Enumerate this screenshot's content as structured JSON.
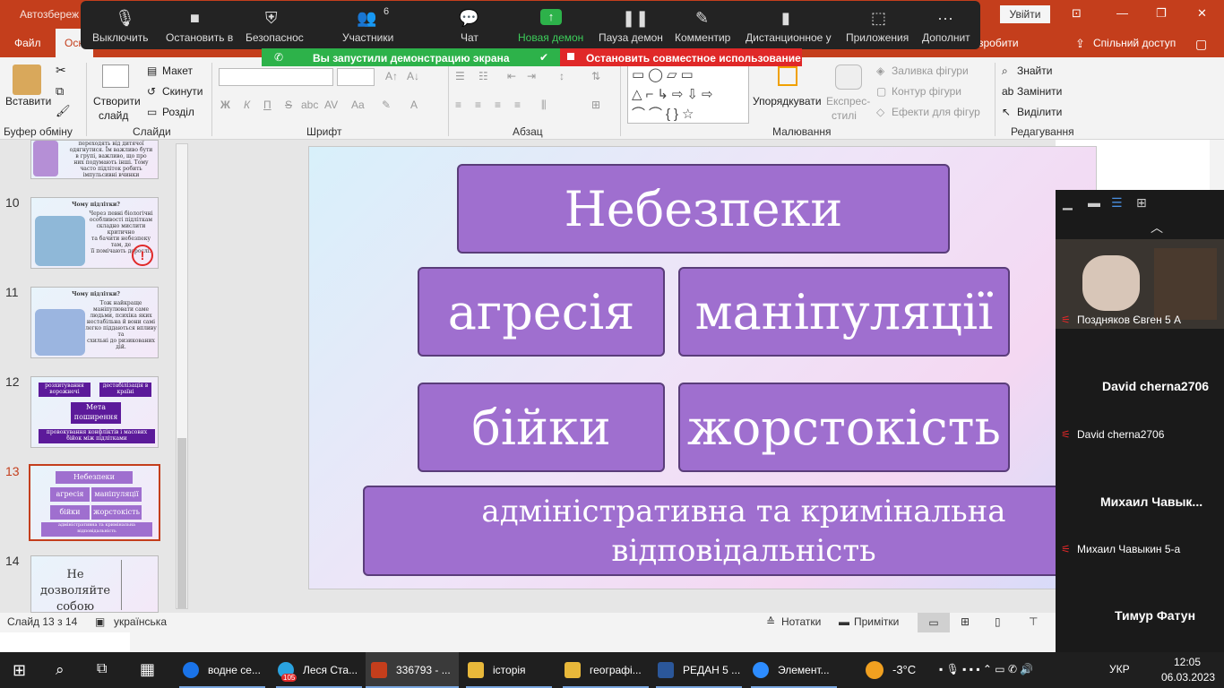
{
  "title_bar": {
    "autosave": "Автозбереж",
    "signin": "Увійти",
    "minimize": "—",
    "maximize": "❐",
    "close": "✕"
  },
  "tabs": {
    "file": "Файл",
    "home": "Осн",
    "tell_me": "зробити",
    "share": "Спільний доступ"
  },
  "zoom": {
    "mute": "Выключить",
    "video": "Остановить в",
    "security": "Безопаснос",
    "participants": "Участники",
    "participants_count": "6",
    "chat": "Чат",
    "share": "Новая демон",
    "pause": "Пауза демон",
    "annotate": "Комментир",
    "remote": "Дистанционное у",
    "apps": "Приложения",
    "more": "Дополнит",
    "banner_sharing": "Вы запустили демонстрацию экрана",
    "banner_stop": "Остановить совместное использование"
  },
  "ribbon": {
    "clipboard": {
      "paste": "Вставити",
      "label": "Буфер обміну"
    },
    "slides": {
      "new_slide_1": "Створити",
      "new_slide_2": "слайд",
      "layout": "Макет",
      "reset": "Скинути",
      "section": "Розділ",
      "label": "Слайди"
    },
    "font": {
      "label": "Шрифт",
      "bold": "Ж",
      "italic": "К",
      "underline": "П",
      "strike": "S",
      "abc": "abc",
      "spacing": "AV",
      "case": "Aa"
    },
    "paragraph": {
      "label": "Абзац"
    },
    "drawing": {
      "arrange": "Упорядкувати",
      "quick_styles_1": "Експрес-",
      "quick_styles_2": "стилі",
      "fill": "Заливка фігури",
      "outline": "Контур фігури",
      "effects": "Ефекти для фігур",
      "label": "Малювання"
    },
    "editing": {
      "find": "Знайти",
      "replace": "Замінити",
      "select": "Виділити",
      "label": "Редагування"
    }
  },
  "thumbnails": [
    {
      "num": "",
      "lines": [
        "переходять від дитячої",
        "одягнутися. Їм важливо бути",
        "в групі, важливо, що про",
        "них подумають інші. Тому",
        "часто підліток робить",
        "імпульсивні вчинки"
      ]
    },
    {
      "num": "10",
      "title": "Чому підлітки?",
      "lines": [
        "Через певні біологічні",
        "особливості підліткам",
        "складно мислити критично",
        "та бачити небезпеку там, де",
        "її помічають дорослі."
      ]
    },
    {
      "num": "11",
      "title": "Чому підлітки?",
      "lines": [
        "Тож найкраще",
        "маніпулювати саме",
        "людьми, психіка яких",
        "нестабільна й вони самі",
        "легко піддаються впливу та",
        "схильні до ризикованих дій."
      ]
    },
    {
      "num": "12",
      "boxes": [
        "розхитування ворожнечі",
        "дестабілізація в країні",
        "Мета поширення",
        "провокування конфліктів і масових бійок між підлітками"
      ]
    },
    {
      "num": "13",
      "boxes": [
        "Небезпеки",
        "агресія",
        "маніпуляції",
        "бійки",
        "жорстокість",
        "адміністративна та кримінальна відповідальність"
      ]
    },
    {
      "num": "14",
      "title": "Не дозволяйте собою маніпулювати!"
    }
  ],
  "slide": {
    "title": "Небезпеки",
    "b1": "агресія",
    "b2": "маніпуляції",
    "b3": "бійки",
    "b4": "жорстокість",
    "b5_line1": "адміністративна та кримінальна",
    "b5_line2": "відповідальність"
  },
  "status": {
    "slide_counter": "Слайд 13 з 14",
    "language": "українська",
    "notes": "Нотатки",
    "comments": "Примітки"
  },
  "gallery": {
    "participants": [
      {
        "name": "Поздняков Євген 5 А",
        "video": true
      },
      {
        "big": "David cherna2706",
        "name": "David cherna2706"
      },
      {
        "big": "Михаил  Чавык...",
        "name": "Михаил Чавыкин 5-а"
      },
      {
        "big": "Тимур Фатун",
        "name": ""
      }
    ]
  },
  "taskbar": {
    "items": [
      {
        "label": "водне се...",
        "color": "#1a73e8"
      },
      {
        "label": "Леся Ста...",
        "color": "#2aa3e0",
        "badge": "105"
      },
      {
        "label": "336793 - ...",
        "color": "#c43e1c"
      },
      {
        "label": "історія",
        "color": "#e8b83a"
      },
      {
        "label": "географі...",
        "color": "#e8b83a"
      },
      {
        "label": "РЕДАН 5 ...",
        "color": "#2b579a"
      },
      {
        "label": "Элемент...",
        "color": "#2d8cff"
      }
    ],
    "weather": "-3°C",
    "lang": "УКР",
    "time": "12:05",
    "date": "06.03.2023"
  },
  "colors": {
    "ppt": "#c43e1c",
    "zoom_green": "#2db24a",
    "zoom_red": "#e02828",
    "box": "#9f6fcf"
  }
}
